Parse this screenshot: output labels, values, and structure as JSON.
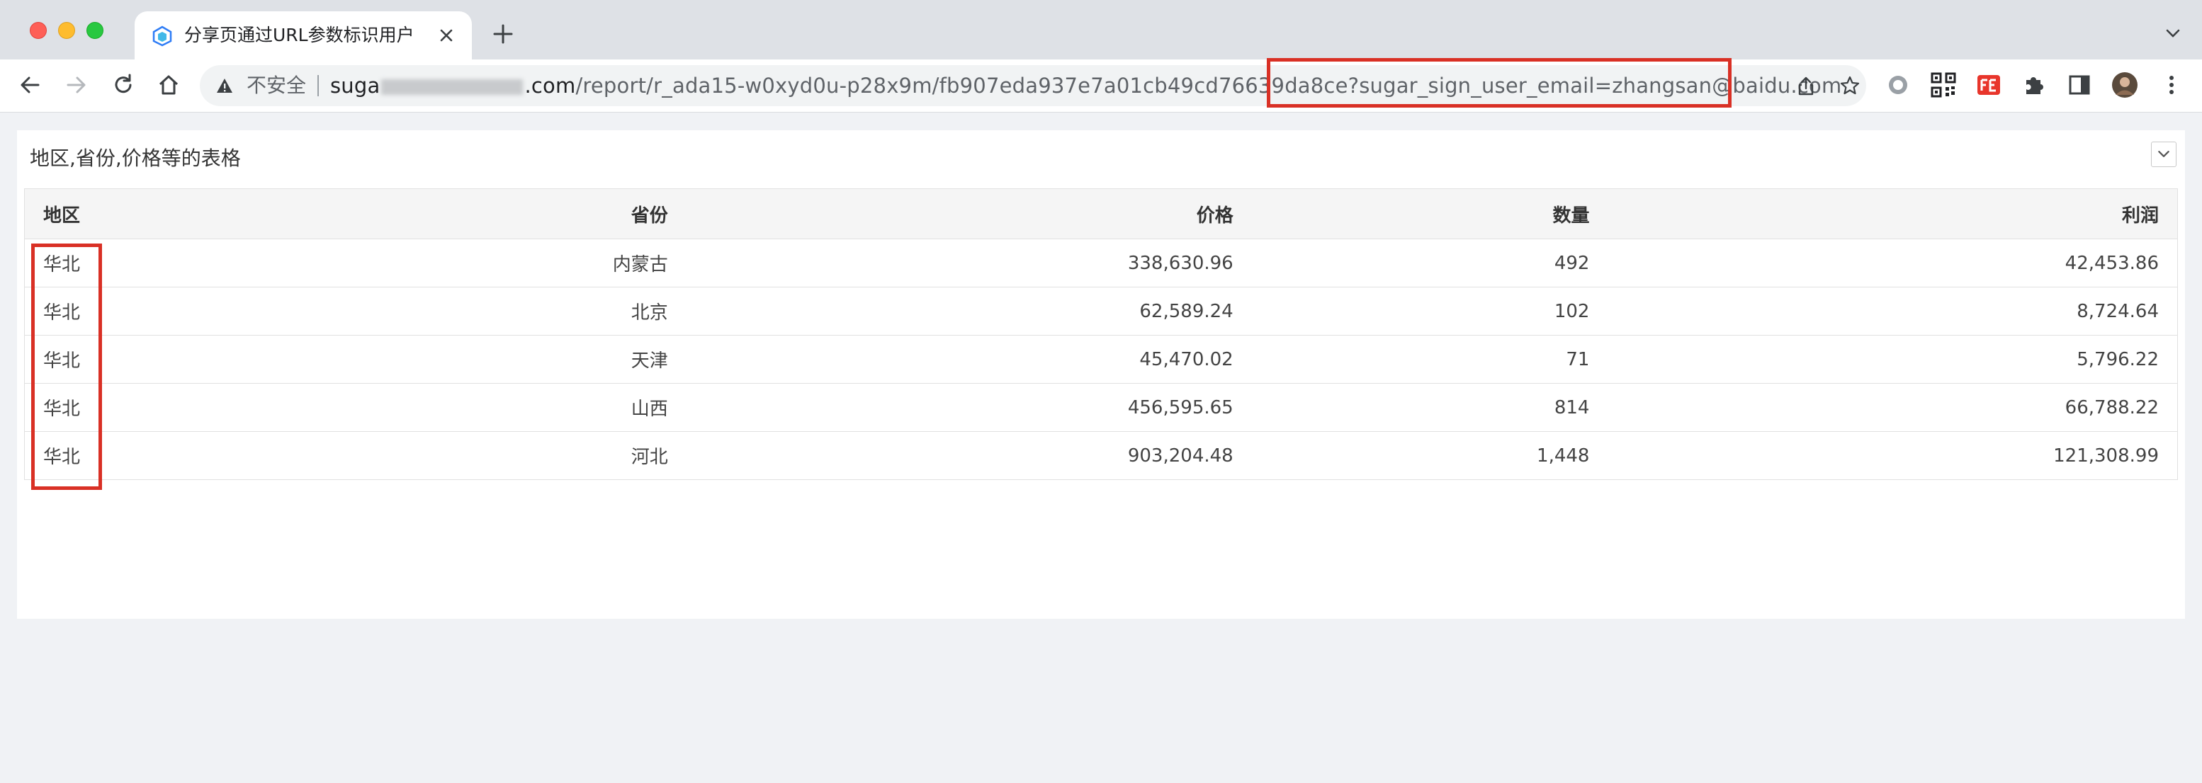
{
  "browser": {
    "tab_title": "分享页通过URL参数标识用户",
    "security_label": "不安全",
    "url_host_visible": "suga",
    "url_host_tail": ".com",
    "url_path": "/report/r_ada15-w0xyd0u-p28x9m/fb907eda937e7a01cb49cd76639da8ce",
    "url_query": "?sugar_sign_user_email=zhangsan@baidu.com"
  },
  "colors": {
    "highlight": "#d93025",
    "header_bg": "#f5f5f5",
    "page_bg": "#f0f2f5"
  },
  "report": {
    "title": "地区,省份,价格等的表格",
    "columns": [
      "地区",
      "省份",
      "价格",
      "数量",
      "利润"
    ],
    "rows": [
      [
        "华北",
        "内蒙古",
        "338,630.96",
        "492",
        "42,453.86"
      ],
      [
        "华北",
        "北京",
        "62,589.24",
        "102",
        "8,724.64"
      ],
      [
        "华北",
        "天津",
        "45,470.02",
        "71",
        "5,796.22"
      ],
      [
        "华北",
        "山西",
        "456,595.65",
        "814",
        "66,788.22"
      ],
      [
        "华北",
        "河北",
        "903,204.48",
        "1,448",
        "121,308.99"
      ]
    ]
  }
}
